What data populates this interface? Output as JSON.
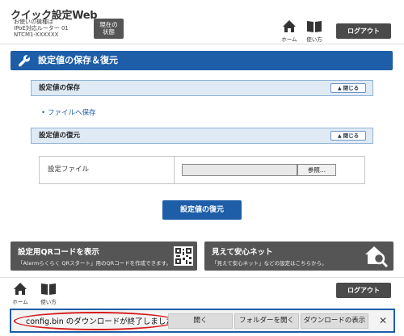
{
  "header": {
    "app_title": "クイック設定Web",
    "device_lines": [
      "お使いの機種は",
      "IPoE対応ルーター 01",
      "NTCM1-XXXXXX"
    ],
    "status_button": [
      "現在の",
      "状態"
    ],
    "home_label": "ホーム",
    "manual_label": "使い方",
    "logout_label": "ログアウト"
  },
  "main": {
    "title": "設定値の保存＆復元",
    "save_section": {
      "title": "設定値の保存",
      "close_label": "閉じる",
      "link_label": "ファイルへ保存"
    },
    "restore_section": {
      "title": "設定値の復元",
      "close_label": "閉じる",
      "file_label": "設定ファイル",
      "browse_label": "参照...",
      "submit_label": "設定値の復元"
    }
  },
  "banners": [
    {
      "title": "設定用QRコードを表示",
      "desc": "「Atermらくらく QRスタート」用のQRコードを作成できます。"
    },
    {
      "title": "見えて安心ネット",
      "desc": "「見えて安心ネット」などの設定はこちらから。"
    }
  ],
  "footer": {
    "home_label": "ホーム",
    "manual_label": "使い方",
    "logout_label": "ログアウト"
  },
  "download_bar": {
    "message": "config.bin のダウンロードが終了しました。",
    "open_label": "開く",
    "open_folder_label": "フォルダーを開く",
    "show_downloads_label": "ダウンロードの表示",
    "close_glyph": "✕"
  },
  "colors": {
    "brand_blue": "#1e5da8",
    "dark_gray": "#555555",
    "highlight_red": "#d61a1a"
  }
}
